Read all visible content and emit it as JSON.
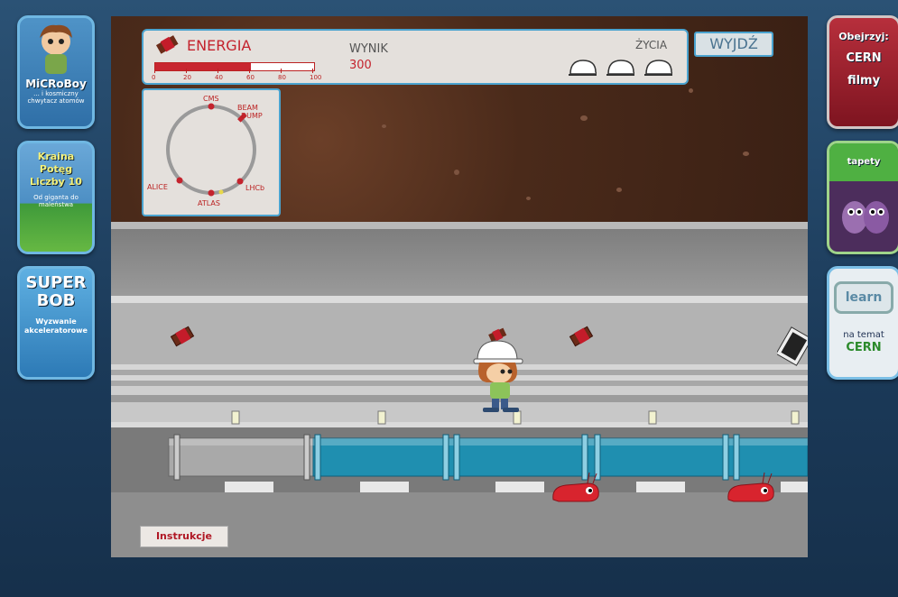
{
  "sidebar_left": {
    "microboy": {
      "title": "MiCRoBoy",
      "subtitle": "... i kosmiczny chwytacz atomów"
    },
    "kraina": {
      "title": "Kraina Potęg Liczby 10",
      "subtitle": "Od giganta do maleństwa"
    },
    "superbob": {
      "title": "SUPER BOB",
      "subtitle": "Wyzwanie akceleratorowe"
    }
  },
  "sidebar_right": {
    "cern": {
      "line1": "Obejrzyj:",
      "line2": "CERN",
      "line3": "filmy"
    },
    "tapety": {
      "label": "tapety"
    },
    "learn": {
      "logo": "learn",
      "line1": "na temat",
      "line2": "CERN"
    }
  },
  "hud": {
    "energy_label": "ENERGIA",
    "energy_value": 60,
    "energy_ticks": [
      "0",
      "20",
      "40",
      "60",
      "80",
      "100"
    ],
    "score_label": "WYNIK",
    "score_value": "300",
    "lives_label": "ŻYCIA",
    "lives_count": 3,
    "exit_label": "WYJDŹ"
  },
  "minimap": {
    "labels": {
      "cms": "CMS",
      "beam_dump_1": "BEAM",
      "beam_dump_2": "DUMP",
      "alice": "ALICE",
      "atlas": "ATLAS",
      "lhcb": "LHCb"
    }
  },
  "instructions_label": "Instrukcje",
  "colors": {
    "accent": "#c4232d",
    "frame": "#4aa3cf",
    "pipe": "#1f8fb0"
  }
}
